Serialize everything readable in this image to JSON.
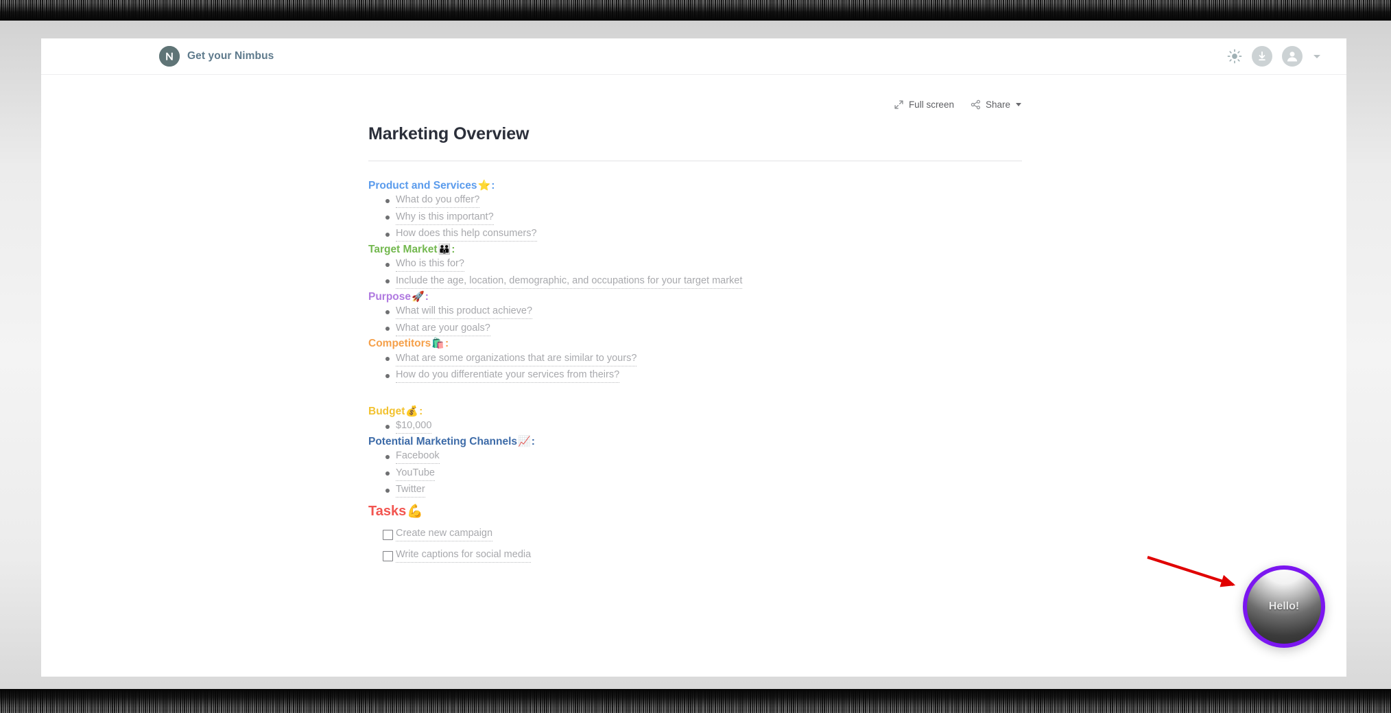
{
  "window": {
    "brand_name": "Get your Nimbus",
    "logo_letter": "N"
  },
  "topbar": {
    "icons": [
      {
        "name": "brightness-icon",
        "label": "Brightness"
      },
      {
        "name": "download-icon",
        "label": "Download"
      },
      {
        "name": "account-avatar-icon",
        "label": "Account"
      },
      {
        "name": "chevron-down-icon",
        "label": "Account menu"
      }
    ]
  },
  "doc_toolbar": {
    "fullscreen_label": "Full screen",
    "share_label": "Share"
  },
  "document": {
    "title": "Marketing Overview",
    "sections": [
      {
        "heading": "Product and Services",
        "emoji": "⭐",
        "suffix": ":",
        "color": "#5a9bec",
        "items": [
          "What do you offer?",
          "Why is this important?",
          "How does this help consumers?"
        ]
      },
      {
        "heading": "Target Market",
        "emoji": "👪",
        "suffix": ":",
        "color": "#73b84f",
        "items": [
          "Who is this for?",
          "Include the age, location, demographic, and occupations for your target market"
        ]
      },
      {
        "heading": "Purpose",
        "emoji": "🚀",
        "suffix": ":",
        "color": "#b07ae0",
        "items": [
          "What will this product achieve?",
          "What are your goals?"
        ]
      },
      {
        "heading": "Competitors",
        "emoji": "🛍️",
        "suffix": ":",
        "color": "#f5a04a",
        "items": [
          "What are some organizations that are similar to yours?",
          "How do you differentiate your services from theirs?"
        ]
      },
      {
        "heading": "Budget",
        "emoji": "💰",
        "suffix": ":",
        "color": "#f2c230",
        "items": [
          "$10,000"
        ]
      },
      {
        "heading": "Potential Marketing Channels",
        "emoji": "📈",
        "suffix": ":",
        "color": "#3d6ba8",
        "items": [
          "Facebook",
          "YouTube",
          "Twitter"
        ]
      }
    ],
    "tasks_section": {
      "heading": "Tasks",
      "emoji": "💪",
      "suffix": "",
      "color": "#f25550",
      "tasks": [
        {
          "label": "Create new campaign",
          "checked": false
        },
        {
          "label": "Write captions for social media",
          "checked": false
        }
      ]
    }
  },
  "hello_widget": {
    "label": "Hello!",
    "ring_color": "#7b16f0"
  }
}
